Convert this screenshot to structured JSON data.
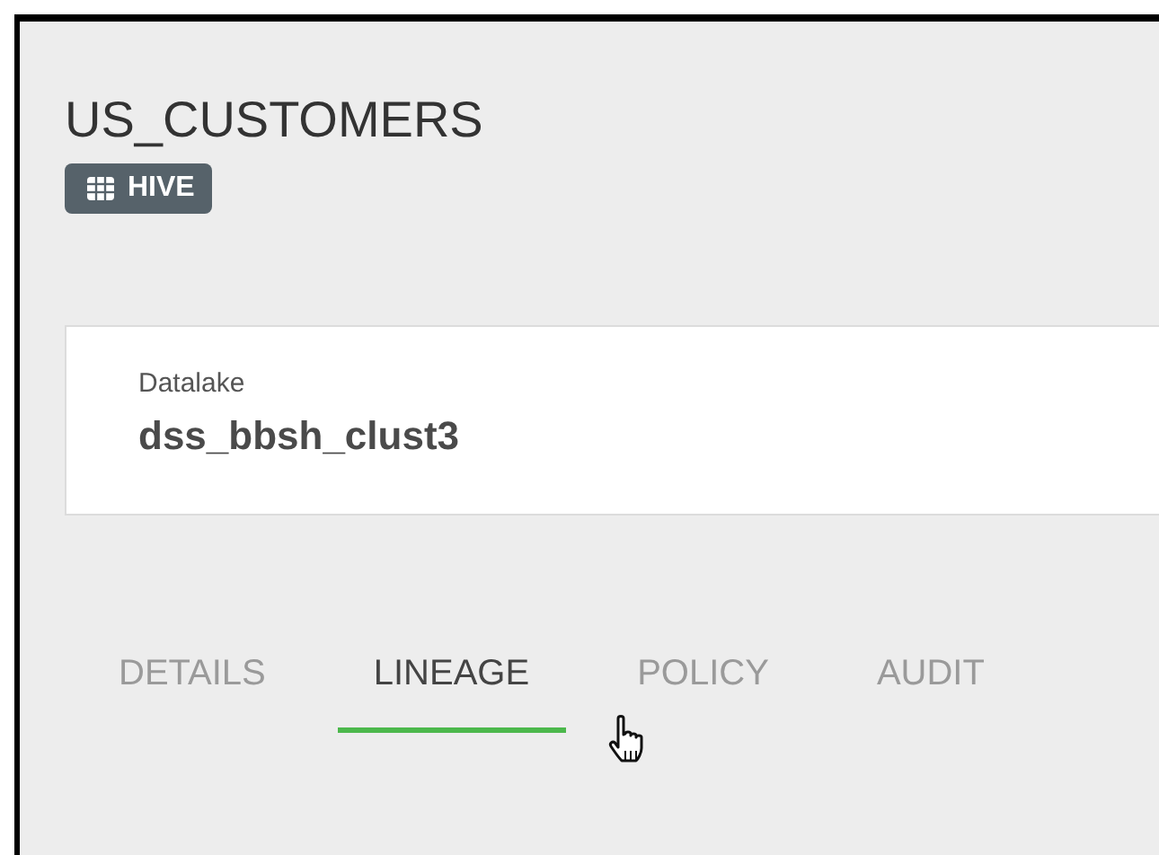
{
  "header": {
    "title": "US_CUSTOMERS",
    "badge": "HIVE"
  },
  "info_card": {
    "label": "Datalake",
    "value": "dss_bbsh_clust3"
  },
  "tabs": [
    {
      "label": "DETAILS",
      "selected": false
    },
    {
      "label": "LINEAGE",
      "selected": true
    },
    {
      "label": "POLICY",
      "selected": false
    },
    {
      "label": "AUDIT",
      "selected": false
    }
  ]
}
